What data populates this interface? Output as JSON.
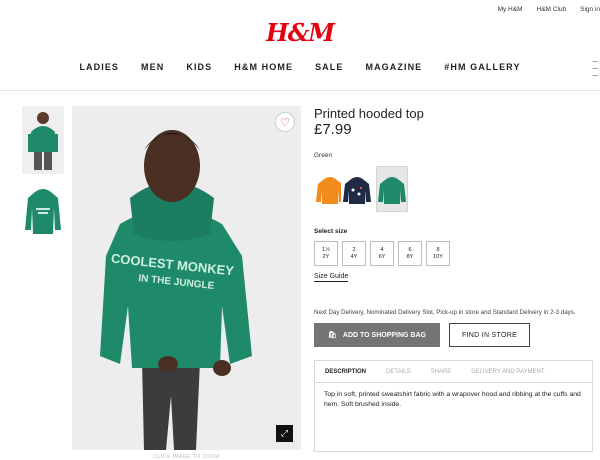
{
  "header": {
    "top_links": [
      "My H&M",
      "H&M Club",
      "Sign in"
    ],
    "logo": "H&M",
    "nav": [
      "LADIES",
      "MEN",
      "KIDS",
      "H&M HOME",
      "SALE",
      "MAGAZINE",
      "#HM GALLERY"
    ]
  },
  "product": {
    "title": "Printed hooded top",
    "price": "£7.99",
    "color_name": "Green",
    "swatches": [
      "orange-hoodie",
      "navy-hoodie",
      "green-hoodie"
    ],
    "size_label": "Select size",
    "sizes": [
      {
        "top": "1½",
        "bottom": "2Y"
      },
      {
        "top": "2",
        "bottom": "4Y"
      },
      {
        "top": "4",
        "bottom": "6Y"
      },
      {
        "top": "6",
        "bottom": "8Y"
      },
      {
        "top": "8",
        "bottom": "10Y"
      }
    ],
    "size_guide": "Size Guide",
    "delivery": "Next Day Delivery, Nominated Delivery Slot, Pick-up in store and Standard Delivery in 2-3 days.",
    "add_to_bag": "ADD TO SHOPPING BAG",
    "find_in_store": "FIND IN STORE",
    "tabs": [
      "DESCRIPTION",
      "DETAILS",
      "SHARE",
      "DELIVERY AND PAYMENT"
    ],
    "description": "Top in soft, printed sweatshirt fabric with a wrapover hood and ribbing at the cuffs and hem. Soft brushed inside.",
    "hoodie_print": [
      "COOLEST MONKEY",
      "IN THE JUNGLE"
    ],
    "zoom_caption": "CLICK IMAGE TO ZOOM"
  },
  "colors": {
    "brand_red": "#e50010",
    "hoodie_green": "#1e8a6a",
    "button_gray": "#747474"
  }
}
